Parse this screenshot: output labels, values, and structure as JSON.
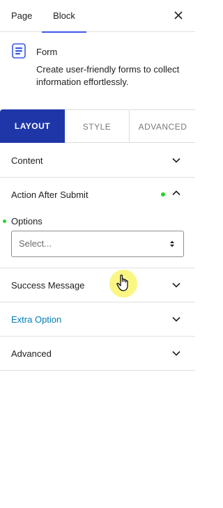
{
  "topbar": {
    "tabs": [
      {
        "label": "Page"
      },
      {
        "label": "Block"
      }
    ],
    "close_icon": "close-icon"
  },
  "block": {
    "icon": "form-icon",
    "title": "Form",
    "description": "Create user-friendly forms to collect information effortlessly."
  },
  "subtabs": [
    {
      "label": "LAYOUT",
      "active": true
    },
    {
      "label": "STYLE",
      "active": false
    },
    {
      "label": "ADVANCED",
      "active": false
    }
  ],
  "panels": {
    "content": {
      "label": "Content"
    },
    "action_after_submit": {
      "label": "Action After Submit",
      "expanded": true,
      "options_label": "Options",
      "select_value": "Select..."
    },
    "success_message": {
      "label": "Success Message"
    },
    "extra_option": {
      "label": "Extra Option"
    },
    "advanced": {
      "label": "Advanced"
    }
  },
  "colors": {
    "accent": "#3858e9",
    "active_tab_bg": "#1e36a8",
    "modified_dot": "#2bd12b",
    "link_text": "#007cba",
    "cursor_highlight": "#faf56e"
  }
}
